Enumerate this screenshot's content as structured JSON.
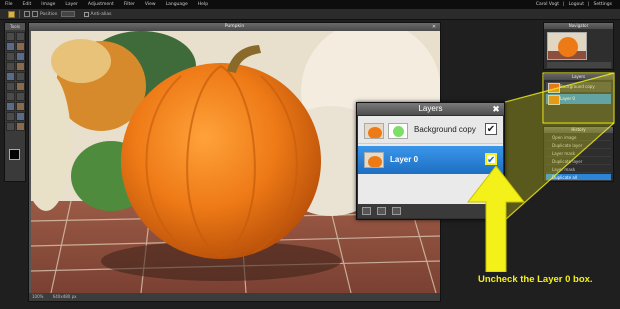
{
  "menubar": {
    "items": [
      "File",
      "Edit",
      "Image",
      "Layer",
      "Adjustment",
      "Filter",
      "View",
      "Language",
      "Help"
    ],
    "user": "Carol Vogt",
    "links": [
      "Logout",
      "Settings"
    ]
  },
  "optbar": {
    "label": "Position",
    "anti_alias": "Anti-alias"
  },
  "tools": {
    "title": "Tools"
  },
  "document": {
    "title": "Pumpkin",
    "status_zoom": "100%",
    "status_size": "640x480 px"
  },
  "navigator": {
    "title": "Navigator"
  },
  "layers_mini": {
    "title": "Layers",
    "rows": [
      "Background copy",
      "Layer 0"
    ]
  },
  "history": {
    "title": "History",
    "rows": [
      "Open image",
      "Duplicate layer",
      "Layer mask",
      "Duplicate layer",
      "Layer mask",
      "Duplicate all"
    ]
  },
  "layers_panel": {
    "title": "Layers",
    "close_symbol": "✖",
    "rows": [
      {
        "name": "Background copy",
        "checked": "✔"
      },
      {
        "name": "Layer 0",
        "checked": "✔"
      }
    ]
  },
  "callout": {
    "caption": "Uncheck the Layer 0 box."
  },
  "colors": {
    "highlight": "#f4f01a",
    "selection_blue": "#2d85d8",
    "pumpkin": "#e8781a"
  },
  "icons": [
    "close-icon",
    "eye-check-icon",
    "new-layer-icon",
    "trash-icon",
    "arrow-up-icon"
  ]
}
